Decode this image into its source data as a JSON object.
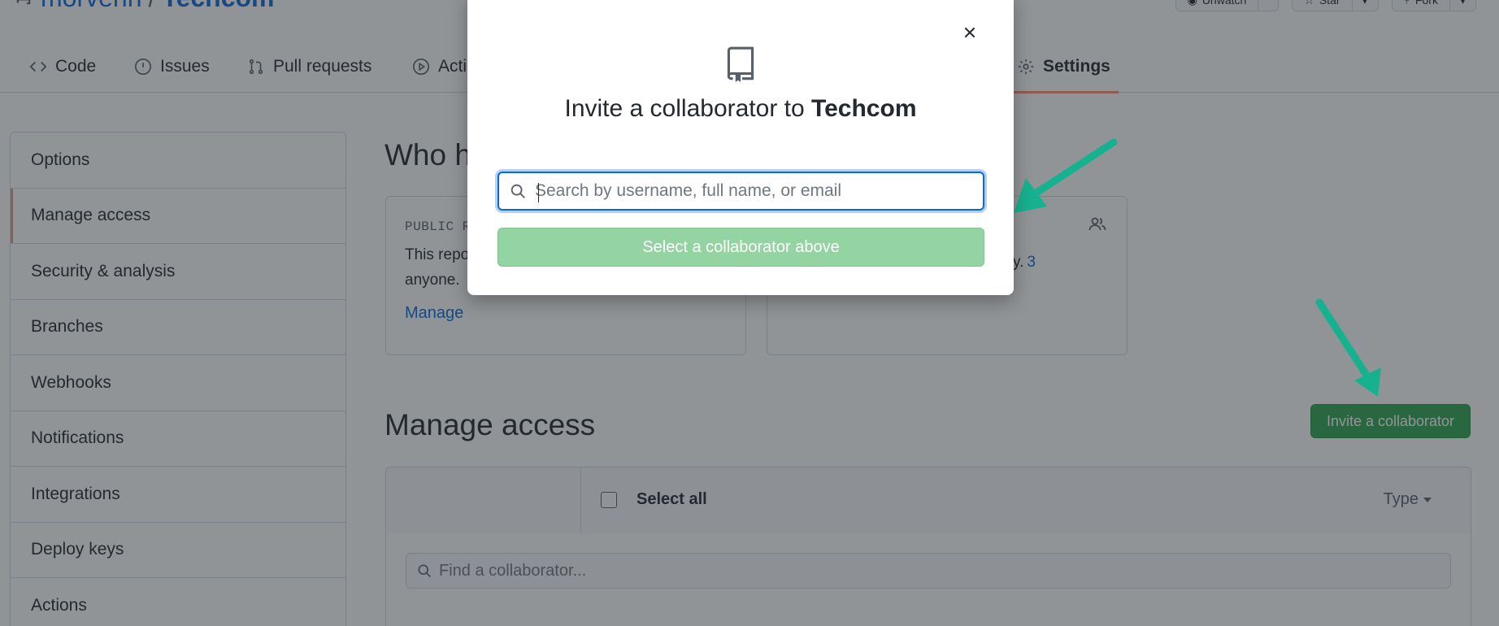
{
  "repo": {
    "owner": "morvenn",
    "separator": "/",
    "name": "Techcom",
    "watch_label": "Unwatch",
    "star_label": "Star",
    "fork_label": "Fork"
  },
  "tabs": [
    {
      "label": "Code",
      "icon": "code-icon"
    },
    {
      "label": "Issues",
      "icon": "issue-icon"
    },
    {
      "label": "Pull requests",
      "icon": "pull-request-icon"
    },
    {
      "label": "Acti",
      "icon": "play-icon"
    },
    {
      "label": "Settings",
      "icon": "gear-icon",
      "selected": true
    }
  ],
  "sidebar": {
    "items": [
      {
        "label": "Options"
      },
      {
        "label": "Manage access",
        "active": true
      },
      {
        "label": "Security & analysis"
      },
      {
        "label": "Branches"
      },
      {
        "label": "Webhooks"
      },
      {
        "label": "Notifications"
      },
      {
        "label": "Integrations"
      },
      {
        "label": "Deploy keys"
      },
      {
        "label": "Actions"
      }
    ]
  },
  "main": {
    "who_title": "Who h",
    "visibility_box": {
      "label": "PUBLIC R",
      "text_line1": "This repo",
      "text_line2": "anyone.",
      "link": "Manage"
    },
    "access_box": {
      "text_tail": "y.",
      "count": "3"
    },
    "manage_title": "Manage access",
    "invite_button": "Invite a collaborator",
    "table": {
      "select_all": "Select all",
      "type_label": "Type",
      "find_placeholder": "Find a collaborator..."
    }
  },
  "modal": {
    "title_prefix": "Invite a collaborator to",
    "repo_name": "Techcom",
    "search_placeholder": "Search by username, full name, or email",
    "search_value": "",
    "submit_label": "Select a collaborator above",
    "close_label": "×"
  },
  "colors": {
    "accent_blue": "#0969da",
    "green_button": "#2da44e",
    "disabled_green": "#94d3a2",
    "tab_underline": "#fd8c73",
    "arrow_teal": "#16b28f"
  }
}
